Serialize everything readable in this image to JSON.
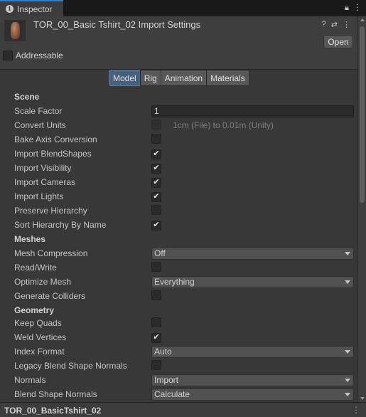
{
  "tab": {
    "label": "Inspector",
    "info_icon": "info-icon",
    "icons": [
      "lock-icon",
      "kebab-menu-icon"
    ]
  },
  "header": {
    "title": "TOR_00_Basic Tshirt_02 Import Settings",
    "open_label": "Open",
    "icons": [
      "help-icon",
      "preset-icon",
      "kebab-menu-icon"
    ],
    "addressable_label": "Addressable"
  },
  "tabs": [
    {
      "label": "Model",
      "active": true
    },
    {
      "label": "Rig",
      "active": false
    },
    {
      "label": "Animation",
      "active": false
    },
    {
      "label": "Materials",
      "active": false
    }
  ],
  "scene": {
    "heading": "Scene",
    "scale_factor_label": "Scale Factor",
    "scale_factor_value": "1",
    "convert_units_label": "Convert Units",
    "convert_units_hint": "1cm (File) to 0.01m (Unity)",
    "bake_axis_label": "Bake Axis Conversion",
    "import_blendshapes_label": "Import BlendShapes",
    "import_visibility_label": "Import Visibility",
    "import_cameras_label": "Import Cameras",
    "import_lights_label": "Import Lights",
    "preserve_hierarchy_label": "Preserve Hierarchy",
    "sort_hierarchy_label": "Sort Hierarchy By Name"
  },
  "meshes": {
    "heading": "Meshes",
    "mesh_compression_label": "Mesh Compression",
    "mesh_compression_value": "Off",
    "read_write_label": "Read/Write",
    "optimize_mesh_label": "Optimize Mesh",
    "optimize_mesh_value": "Everything",
    "generate_colliders_label": "Generate Colliders"
  },
  "geometry": {
    "heading": "Geometry",
    "keep_quads_label": "Keep Quads",
    "weld_vertices_label": "Weld Vertices",
    "index_format_label": "Index Format",
    "index_format_value": "Auto",
    "legacy_blend_label": "Legacy Blend Shape Normals",
    "normals_label": "Normals",
    "normals_value": "Import",
    "blend_shape_normals_label": "Blend Shape Normals",
    "blend_shape_normals_value": "Calculate"
  },
  "checks": {
    "checked": "✔"
  },
  "footer": {
    "name": "TOR_00_BasicTshirt_02",
    "menu": "⋮"
  }
}
